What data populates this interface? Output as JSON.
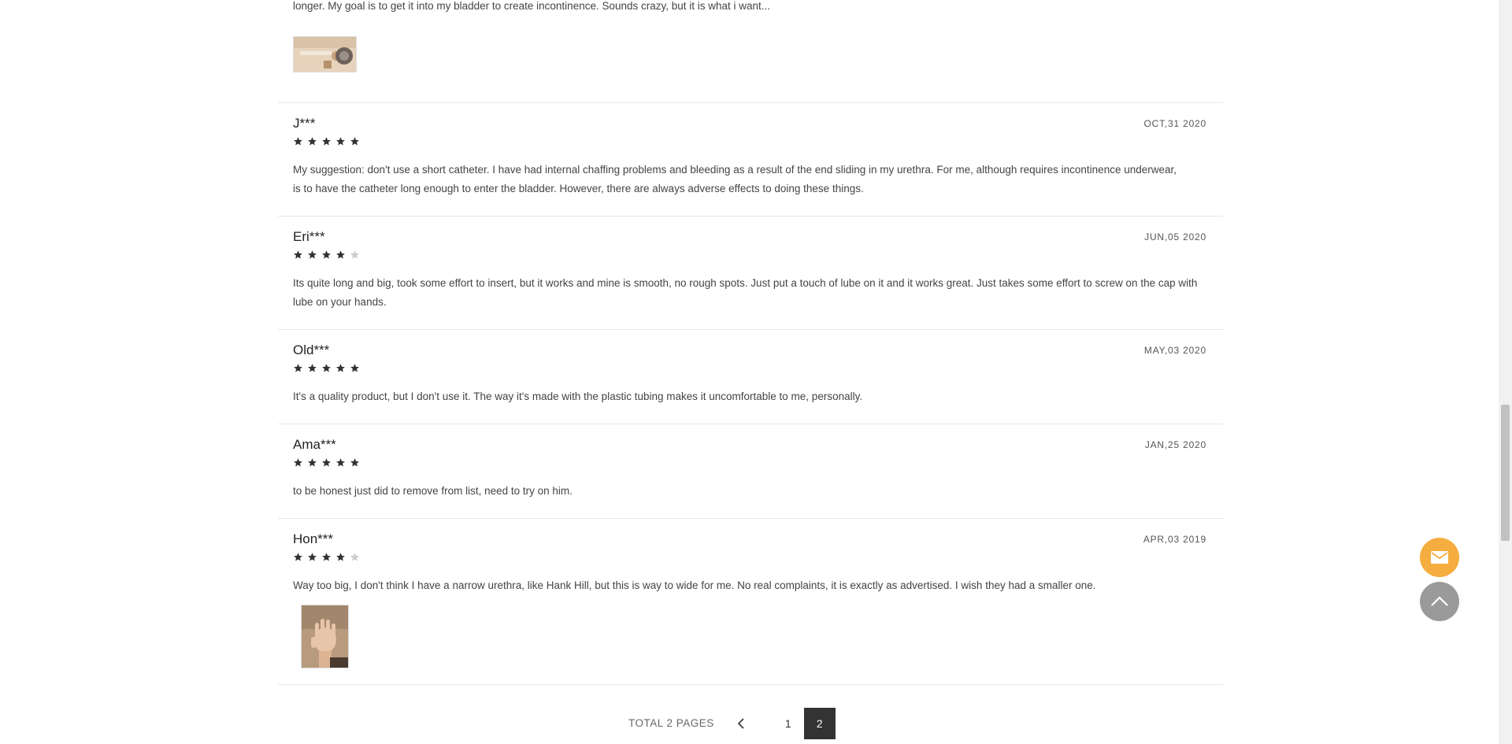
{
  "reviews": [
    {
      "name": "",
      "date": "",
      "rating": 0,
      "text": "longer. My goal is to get it into my bladder to create incontinence. Sounds crazy, but it is what i want...",
      "photo": "product-photo"
    },
    {
      "name": "J***",
      "date": "OCT,31 2020",
      "rating": 5,
      "text": "My suggestion: don't use a short catheter. I have had internal chaffing problems and bleeding as a result of the end sliding in my urethra. For me, although requires incontinence underwear, is to have the catheter long enough to enter the bladder. However, there are always adverse effects to doing these things."
    },
    {
      "name": "Eri***",
      "date": "JUN,05 2020",
      "rating": 4,
      "text": "Its quite long and big, took some effort to insert, but it works and mine is smooth, no rough spots. Just put a touch of lube on it and it works great. Just takes some effort to screw on the cap with lube on your hands."
    },
    {
      "name": "Old***",
      "date": "MAY,03 2020",
      "rating": 5,
      "text": "It's a quality product, but I don't use it. The way it's made with the plastic tubing makes it uncomfortable to me, personally."
    },
    {
      "name": "Ama***",
      "date": "JAN,25 2020",
      "rating": 5,
      "text": "to be honest just did to remove from list, need to try on him."
    },
    {
      "name": "Hon***",
      "date": "APR,03 2019",
      "rating": 4,
      "text": "Way too big, I don't think I have a narrow urethra, like Hank Hill, but this is way to wide for me. No real complaints, it is exactly as advertised. I wish they had a smaller one.",
      "photo": "hand-photo"
    }
  ],
  "pagination": {
    "total_label": "TOTAL 2 PAGES",
    "prev_icon": "chevron-left-icon",
    "pages": [
      "1",
      "2"
    ],
    "current_page": "2"
  },
  "floating": {
    "mail_icon": "envelope-icon",
    "top_icon": "chevron-up-icon"
  },
  "colors": {
    "star_filled": "#333333",
    "star_empty": "#cccccc",
    "mail_button": "#f5ad3f",
    "top_button": "#9a9a9a",
    "active_page": "#333333"
  }
}
